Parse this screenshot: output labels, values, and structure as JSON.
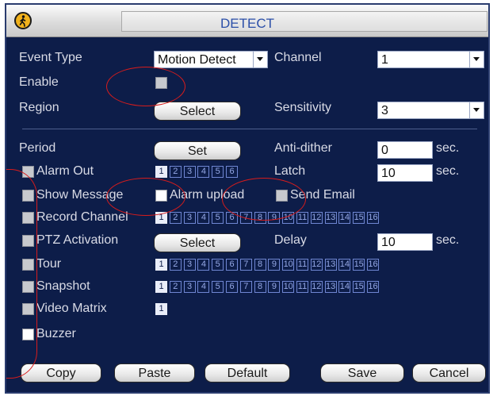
{
  "window": {
    "title": "DETECT"
  },
  "event_type": {
    "label": "Event Type",
    "value": "Motion Detect"
  },
  "channel": {
    "label": "Channel",
    "value": "1"
  },
  "enable": {
    "label": "Enable",
    "checked": false
  },
  "region": {
    "label": "Region",
    "button": "Select"
  },
  "sensitivity": {
    "label": "Sensitivity",
    "value": "3"
  },
  "period": {
    "label": "Period",
    "button": "Set"
  },
  "anti_dither": {
    "label": "Anti-dither",
    "value": "0",
    "unit": "sec."
  },
  "alarm_out": {
    "label": "Alarm Out",
    "channels": [
      "1",
      "2",
      "3",
      "4",
      "5",
      "6"
    ],
    "selected": [
      "1"
    ]
  },
  "latch": {
    "label": "Latch",
    "value": "10",
    "unit": "sec."
  },
  "show_message": {
    "label": "Show Message",
    "checked": false
  },
  "alarm_upload": {
    "label": "Alarm upload",
    "checked": true
  },
  "send_email": {
    "label": "Send Email",
    "checked": false
  },
  "record_channel": {
    "label": "Record Channel",
    "channels": [
      "1",
      "2",
      "3",
      "4",
      "5",
      "6",
      "7",
      "8",
      "9",
      "10",
      "11",
      "12",
      "13",
      "14",
      "15",
      "16"
    ],
    "selected": [
      "1"
    ]
  },
  "ptz_activation": {
    "label": "PTZ Activation",
    "button": "Select"
  },
  "delay": {
    "label": "Delay",
    "value": "10",
    "unit": "sec."
  },
  "tour": {
    "label": "Tour",
    "channels": [
      "1",
      "2",
      "3",
      "4",
      "5",
      "6",
      "7",
      "8",
      "9",
      "10",
      "11",
      "12",
      "13",
      "14",
      "15",
      "16"
    ],
    "selected": [
      "1"
    ]
  },
  "snapshot": {
    "label": "Snapshot",
    "channels": [
      "1",
      "2",
      "3",
      "4",
      "5",
      "6",
      "7",
      "8",
      "9",
      "10",
      "11",
      "12",
      "13",
      "14",
      "15",
      "16"
    ],
    "selected": [
      "1"
    ]
  },
  "video_matrix": {
    "label": "Video Matrix",
    "channels": [
      "1"
    ],
    "selected": [
      "1"
    ]
  },
  "buzzer": {
    "label": "Buzzer",
    "checked": true
  },
  "footer": {
    "copy": "Copy",
    "paste": "Paste",
    "default": "Default",
    "save": "Save",
    "cancel": "Cancel"
  },
  "colors": {
    "background": "#0d1d49",
    "title_text": "#2b4fa8",
    "annotation": "#d71c1c",
    "selected_number": "#e9edf9"
  }
}
